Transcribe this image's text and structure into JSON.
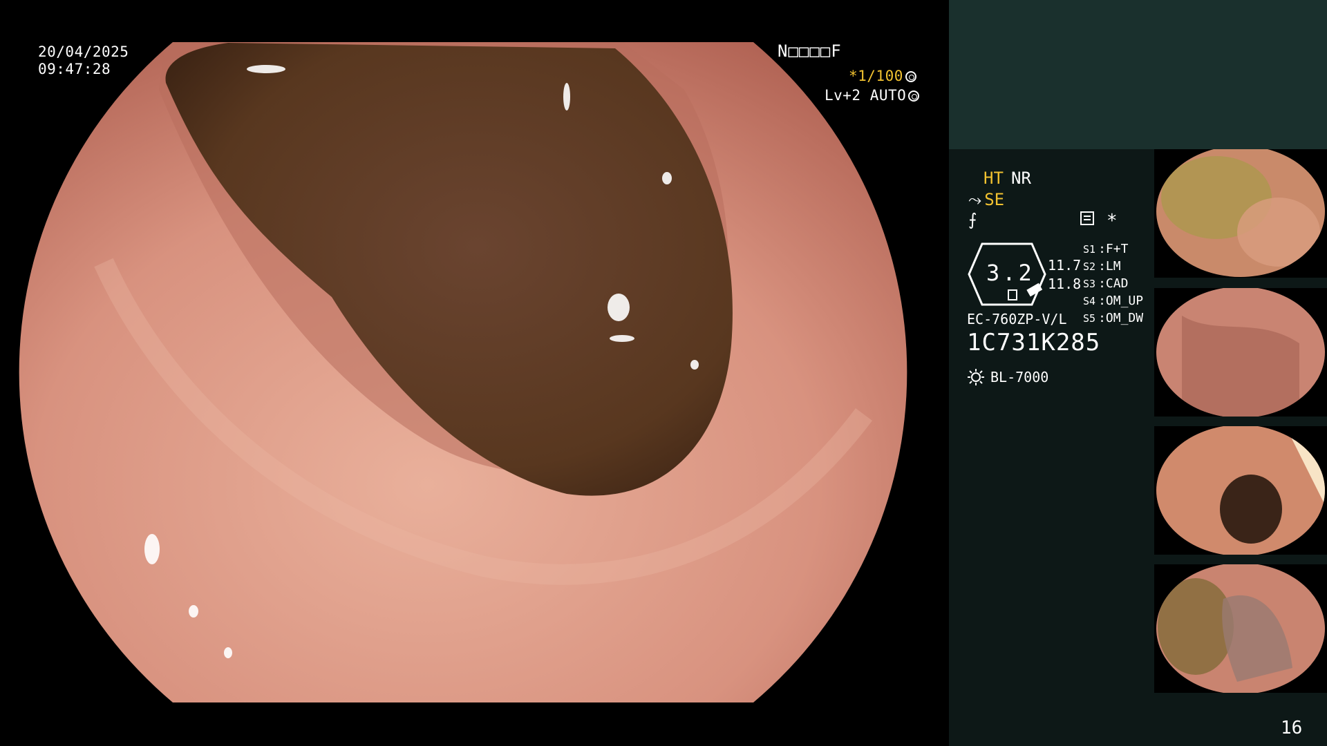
{
  "overlay": {
    "date": "20/04/2025",
    "time": "09:47:28",
    "status_code": "N□□□□F",
    "shutter": "*1/100",
    "level": "Lv+2",
    "iris": "AUTO"
  },
  "panel": {
    "ht": "HT",
    "nr": "NR",
    "se": "SE",
    "zoom": "3.2",
    "value_a": "11.7",
    "value_b": "11.8",
    "slots": [
      {
        "key": "S1",
        "value": "F+T"
      },
      {
        "key": "S2",
        "value": "LM"
      },
      {
        "key": "S3",
        "value": "CAD"
      },
      {
        "key": "S4",
        "value": "OM_UP"
      },
      {
        "key": "S5",
        "value": "OM_DW"
      }
    ],
    "scope_model": "EC-760ZP-V/L",
    "scope_serial": "1C731K285",
    "light_source": "BL-7000",
    "page_number": "16"
  },
  "thumbnails": [
    {
      "label": "captured-image-1"
    },
    {
      "label": "captured-image-2"
    },
    {
      "label": "captured-image-3"
    },
    {
      "label": "captured-image-4"
    }
  ],
  "colors": {
    "accent_yellow": "#f2c230",
    "panel_bg": "#0d1817",
    "panel_top_bg": "#1a302d",
    "mucosa": "#d8927f",
    "lumen_fluid": "#5e3b26"
  }
}
